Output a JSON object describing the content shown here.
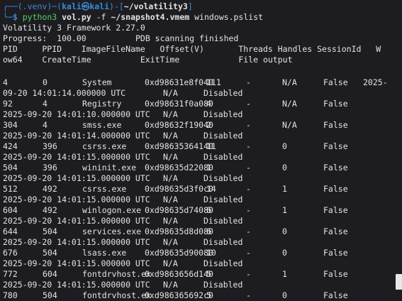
{
  "prompt": {
    "venv": "(.venv)",
    "user": "kali",
    "at": "㉿",
    "host": "kali",
    "path": "~/volatility3",
    "cmd_exe": "python3",
    "cmd_script": "vol.py",
    "cmd_flag": "-f",
    "cmd_file": "~/snapshot4.vmem",
    "cmd_plugin": "windows.pslist"
  },
  "output": {
    "framework": "Volatility 3 Framework 2.27.0",
    "progress_label": "Progress:",
    "progress_value": "100.00",
    "progress_status": "PDB scanning finished",
    "header_1": "PID     PPID    ImageFileName   Offset(V)       Threads Handles SessionId   W",
    "header_2": "ow64    CreateTime          ExitTime            File output"
  },
  "processes": [
    {
      "pid": "4",
      "ppid": "0",
      "name": "System",
      "offset": "0xd98631e8f040",
      "threads": "111",
      "handles": "-",
      "session": "N/A",
      "wow64": "False",
      "create": "2025-",
      "create2": "09-20 14:01:14.000000 UTC",
      "exit": "N/A",
      "output": "Disabled",
      "layout": "wrap"
    },
    {
      "pid": "92",
      "ppid": "4",
      "name": "Registry",
      "offset": "0xd98631f0a080",
      "threads": "4",
      "handles": "-",
      "session": "N/A",
      "wow64": "False",
      "create2": "2025-09-20 14:01:10.000000 UTC",
      "exit": "N/A",
      "output": "Disabled"
    },
    {
      "pid": "304",
      "ppid": "4",
      "name": "smss.exe",
      "offset": "0xd98632f19040",
      "threads": "2",
      "handles": "-",
      "session": "N/A",
      "wow64": "False",
      "create2": "2025-09-20 14:01:14.000000 UTC",
      "exit": "N/A",
      "output": "Disabled"
    },
    {
      "pid": "424",
      "ppid": "396",
      "name": "csrss.exe",
      "offset": "0xd98635364140",
      "threads": "11",
      "handles": "-",
      "session": "0",
      "wow64": "False",
      "create2": "2025-09-20 14:01:15.000000 UTC",
      "exit": "N/A",
      "output": "Disabled"
    },
    {
      "pid": "504",
      "ppid": "396",
      "name": "wininit.exe",
      "offset": "0xd98635d22080",
      "threads": "1",
      "handles": "-",
      "session": "0",
      "wow64": "False",
      "create2": "2025-09-20 14:01:15.000000 UTC",
      "exit": "N/A",
      "output": "Disabled"
    },
    {
      "pid": "512",
      "ppid": "492",
      "name": "csrss.exe",
      "offset": "0xd98635d3f0c0",
      "threads": "14",
      "handles": "-",
      "session": "1",
      "wow64": "False",
      "create2": "2025-09-20 14:01:15.000000 UTC",
      "exit": "N/A",
      "output": "Disabled"
    },
    {
      "pid": "604",
      "ppid": "492",
      "name": "winlogon.exe",
      "offset": "0xd98635d74080",
      "threads": "6",
      "handles": "-",
      "session": "1",
      "wow64": "False",
      "create2": "2025-09-20 14:01:15.000000 UTC",
      "exit": "N/A",
      "output": "Disabled"
    },
    {
      "pid": "644",
      "ppid": "504",
      "name": "services.exe",
      "offset": "0xd98635d8d080",
      "threads": "6",
      "handles": "-",
      "session": "0",
      "wow64": "False",
      "create2": "2025-09-20 14:01:15.000000 UTC",
      "exit": "N/A",
      "output": "Disabled"
    },
    {
      "pid": "676",
      "ppid": "504",
      "name": "lsass.exe",
      "offset": "0xd98635d90080",
      "threads": "10",
      "handles": "-",
      "session": "0",
      "wow64": "False",
      "create2": "2025-09-20 14:01:15.000000 UTC",
      "exit": "N/A",
      "output": "Disabled"
    },
    {
      "pid": "772",
      "ppid": "604",
      "name": "fontdrvhost.ex",
      "offset": "0xd9863656d140",
      "threads": "5",
      "handles": "-",
      "session": "1",
      "wow64": "False",
      "create2": "2025-09-20 14:01:15.000000 UTC",
      "exit": "N/A",
      "output": "Disabled"
    },
    {
      "pid": "780",
      "ppid": "504",
      "name": "fontdrvhost.ex",
      "offset": "0xd986365692c0",
      "threads": "5",
      "handles": "-",
      "session": "0",
      "wow64": "False"
    }
  ],
  "colors": {
    "background": "#1d1d21",
    "prompt_blue": "#3b8bd8",
    "command_green": "#4fcf6f",
    "text": "#e3e3e3"
  }
}
